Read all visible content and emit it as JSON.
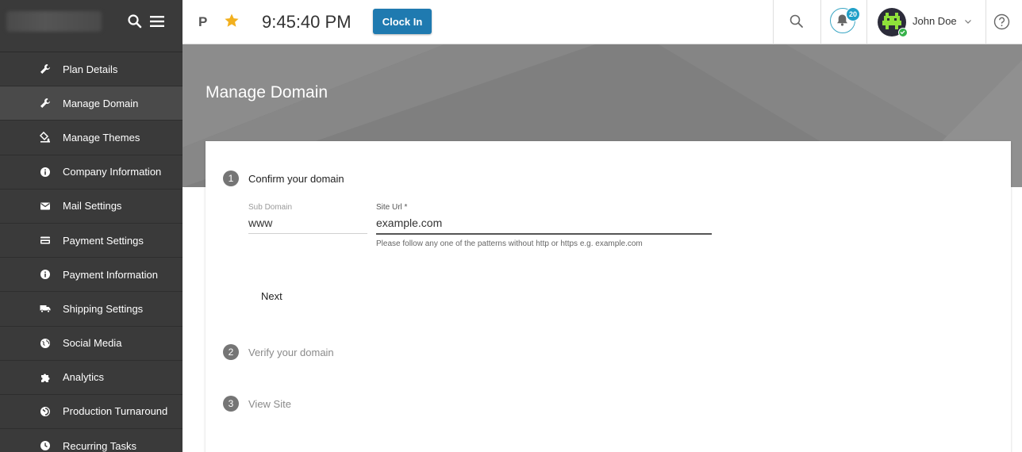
{
  "sidebar": {
    "items": [
      {
        "label": "Plan Details",
        "icon": "wrench-icon",
        "active": false
      },
      {
        "label": "Manage Domain",
        "icon": "wrench-icon",
        "active": true
      },
      {
        "label": "Manage Themes",
        "icon": "paint-bucket-icon",
        "active": false
      },
      {
        "label": "Company Information",
        "icon": "info-icon",
        "active": false
      },
      {
        "label": "Mail Settings",
        "icon": "mail-icon",
        "active": false
      },
      {
        "label": "Payment Settings",
        "icon": "credit-card-icon",
        "active": false
      },
      {
        "label": "Payment Information",
        "icon": "info-icon",
        "active": false
      },
      {
        "label": "Shipping Settings",
        "icon": "truck-icon",
        "active": false
      },
      {
        "label": "Social Media",
        "icon": "globe-icon",
        "active": false
      },
      {
        "label": "Analytics",
        "icon": "puzzle-icon",
        "active": false
      },
      {
        "label": "Production Turnaround",
        "icon": "dial-icon",
        "active": false
      },
      {
        "label": "Recurring Tasks",
        "icon": "clock-icon",
        "active": false
      }
    ]
  },
  "topbar": {
    "p_label": "P",
    "time": "9:45:40 PM",
    "clock_in_label": "Clock In",
    "notification_count": "20",
    "user_name": "John Doe"
  },
  "page": {
    "title": "Manage Domain"
  },
  "steps": [
    {
      "number": "1",
      "label": "Confirm your domain"
    },
    {
      "number": "2",
      "label": "Verify your domain"
    },
    {
      "number": "3",
      "label": "View Site"
    }
  ],
  "form": {
    "sub_domain_label": "Sub Domain",
    "sub_domain_value": "www",
    "site_url_label": "Site Url *",
    "site_url_value": "example.com",
    "site_url_hint": "Please follow any one of the patterns without http or https e.g. example.com",
    "next_label": "Next"
  },
  "colors": {
    "sidebar_bg": "#3a3a3a",
    "accent": "#1f7ab0",
    "badge": "#21a0c8",
    "star": "#f2b01e"
  }
}
